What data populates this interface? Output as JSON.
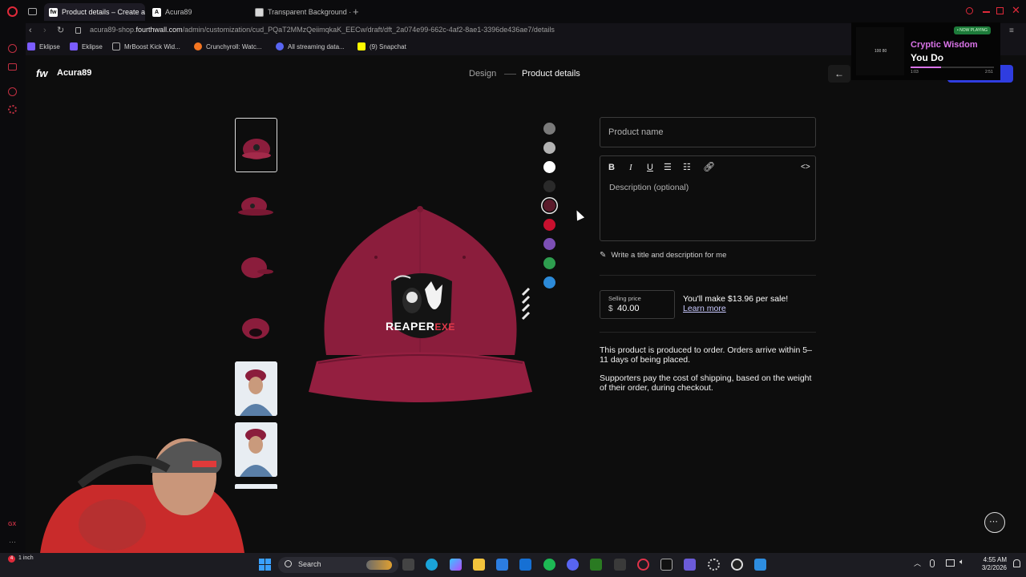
{
  "browser": {
    "tabs": [
      {
        "label": "Product details – Create a",
        "favicon": "fw"
      },
      {
        "label": "Acura89",
        "favicon": "A"
      },
      {
        "label": "Transparent Background ·",
        "favicon": "transparent-icon"
      }
    ],
    "url_prefix": "acura89-shop.",
    "url_domain": "fourthwall.com",
    "url_path": "/admin/customization/cud_PQaT2MMzQeiimqkaK_EECw/draft/dft_2a074e99-662c-4af2-8ae1-3396de436ae7/details",
    "bookmarks": [
      "Eklipse",
      "Eklipse",
      "MrBoost Kick Wid...",
      "Crunchyroll: Watc...",
      "All streaming data...",
      "(9) Snapchat"
    ]
  },
  "app": {
    "logo": "fw",
    "store_name": "Acura89",
    "steps": {
      "design": "Design",
      "product_details": "Product details"
    },
    "colors": {
      "accent": "#8e1c3a",
      "hat": "#8b1d3c",
      "link": "#c9c9ff"
    },
    "swatches": [
      "#7a7a7a",
      "#b3b3b3",
      "#ffffff",
      "#2a2a2a",
      "#5a1a2a",
      "#c8102e",
      "#7c4fb5",
      "#2e9e4f",
      "#2c8ad8"
    ],
    "selected_swatch_index": 4,
    "thumbnails": [
      "hat-front",
      "hat-side",
      "hat-back",
      "hat-underbill",
      "model-front",
      "model-tilt"
    ],
    "hat_logo": {
      "text": "REAPER",
      "text_red": "EXE"
    },
    "form": {
      "product_name_placeholder": "Product name",
      "description_placeholder": "Description (optional)",
      "ai_link": "Write a title and description for me",
      "toolbar": {
        "bold": "B",
        "italic": "I",
        "underline": "U",
        "code": "<>"
      },
      "price_label": "Selling price",
      "currency": "$",
      "price_value": "40.00",
      "earn_text": "You'll make $13.96 per sale!",
      "learn_more": "Learn more",
      "info_1": "This product is produced to order. Orders arrive within 5–11 days of being placed.",
      "info_2": "Supporters pay the cost of shipping, based on the weight of their order, during checkout."
    }
  },
  "now_playing": {
    "badge": "• NOW PLAYING",
    "album_label": "100 80",
    "title": "Cryptic Wisdom",
    "subtitle": "You Do",
    "elapsed": "1:03",
    "duration": "2:51",
    "progress": 0.37
  },
  "taskbar": {
    "search": "Search",
    "weather_temp": "1 inch",
    "clock_time": "4:55 AM",
    "clock_date": "3/2/2026"
  }
}
